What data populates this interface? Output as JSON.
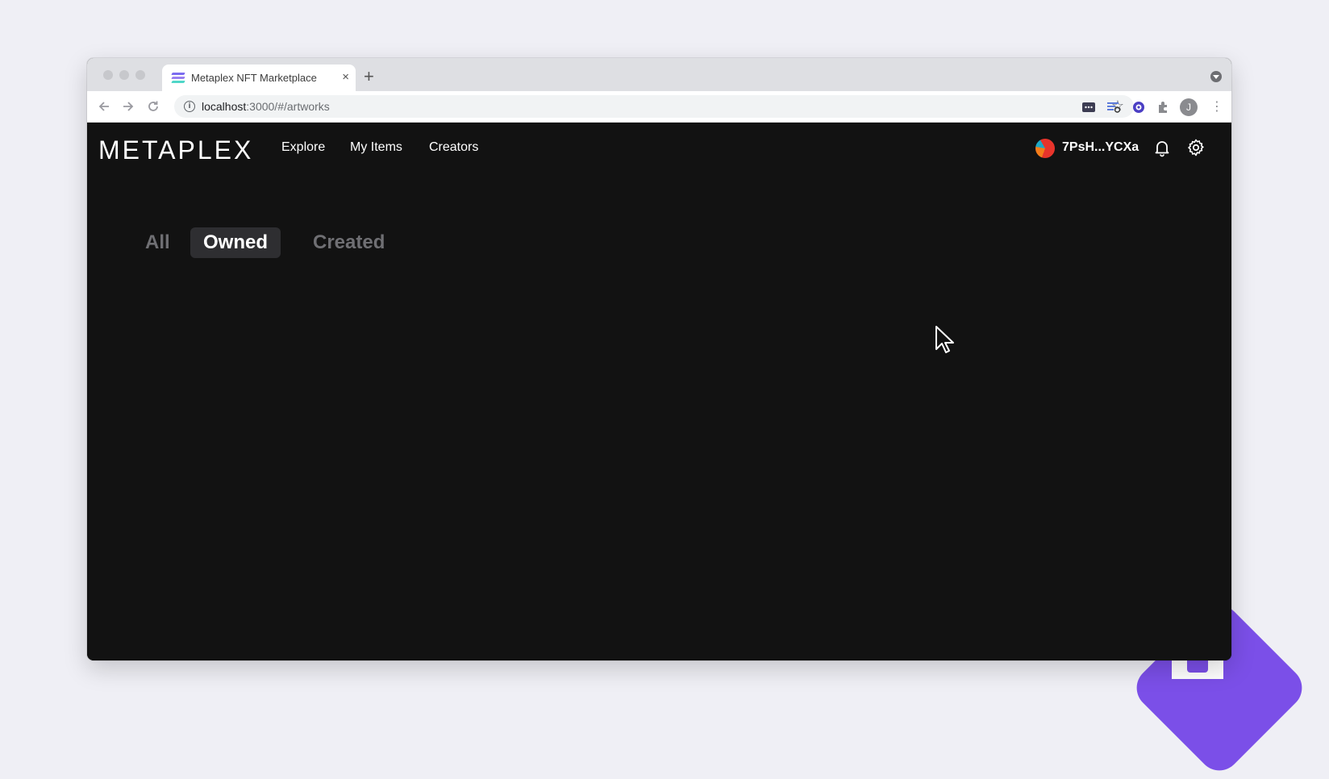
{
  "browser": {
    "tab_title": "Metaplex NFT Marketplace",
    "tab_close": "×",
    "new_tab": "+",
    "url_host": "localhost",
    "url_path": ":3000/#/artworks",
    "profile_initial": "J",
    "icons": [
      "back-arrow-icon",
      "forward-arrow-icon",
      "reload-icon",
      "site-info-icon",
      "bookmark-star-icon",
      "extension-icon",
      "kebab-menu-icon"
    ]
  },
  "app": {
    "logo": "METAPLEX",
    "nav": [
      "Explore",
      "My Items",
      "Creators"
    ],
    "wallet_address": "7PsH...YCXa",
    "filters": [
      {
        "label": "All",
        "active": false
      },
      {
        "label": "Owned",
        "active": true
      },
      {
        "label": "Created",
        "active": false
      }
    ]
  },
  "colors": {
    "app_background": "#121212",
    "active_filter_bg": "#2e2e31",
    "inactive_filter_text": "#6f6f73",
    "brand_purple": "#7b4fe8"
  }
}
